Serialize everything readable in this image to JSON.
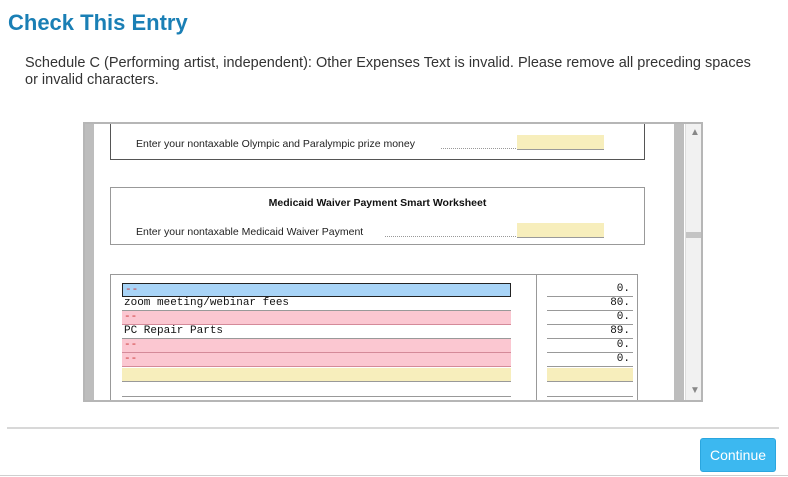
{
  "dialog": {
    "title": "Check This Entry",
    "message": "Schedule C (Performing artist, independent): Other Expenses Text is invalid.  Please remove all preceding spaces or invalid characters.",
    "continue_label": "Continue"
  },
  "form": {
    "olympic_label": "Enter your nontaxable Olympic and Paralympic prize money",
    "medicaid_title": "Medicaid Waiver Payment Smart Worksheet",
    "medicaid_label": "Enter your nontaxable Medicaid Waiver Payment",
    "expense_rows": [
      {
        "description": "--",
        "amount": "0.",
        "style": "blue"
      },
      {
        "description": "zoom meeting/webinar fees",
        "amount": "80.",
        "style": "plain"
      },
      {
        "description": "--",
        "amount": "0.",
        "style": "pink"
      },
      {
        "description": "PC Repair Parts",
        "amount": "89.",
        "style": "plain"
      },
      {
        "description": "--",
        "amount": "0.",
        "style": "pink"
      },
      {
        "description": "--",
        "amount": "0.",
        "style": "pink"
      }
    ]
  },
  "icons": {
    "scroll_up": "▲",
    "scroll_down": "▼"
  }
}
